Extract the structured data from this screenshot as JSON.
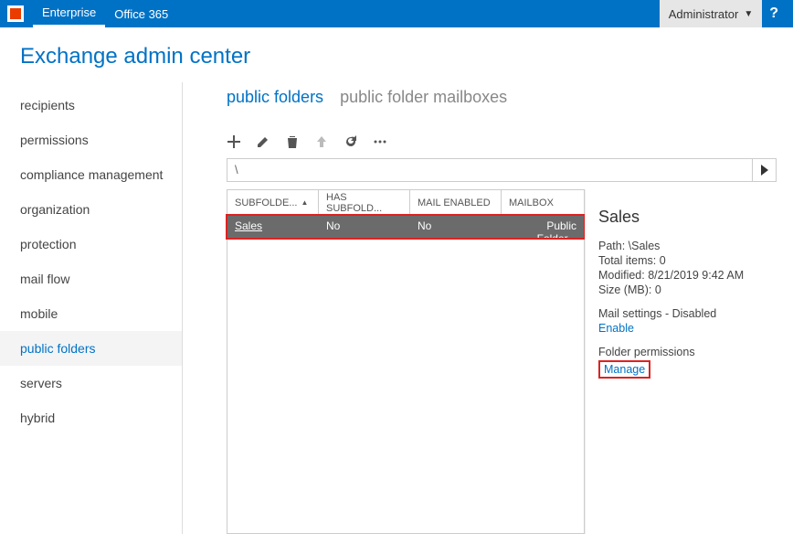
{
  "topbar": {
    "tabs": [
      "Enterprise",
      "Office 365"
    ],
    "active_tab": 0,
    "user": "Administrator",
    "help": "?"
  },
  "page_title": "Exchange admin center",
  "sidebar": {
    "items": [
      "recipients",
      "permissions",
      "compliance management",
      "organization",
      "protection",
      "mail flow",
      "mobile",
      "public folders",
      "servers",
      "hybrid"
    ],
    "active_index": 7
  },
  "content_tabs": {
    "items": [
      "public folders",
      "public folder mailboxes"
    ],
    "active_index": 0
  },
  "toolbar_icons": [
    "add",
    "edit",
    "delete",
    "up",
    "refresh",
    "more"
  ],
  "path": "\\",
  "grid": {
    "columns": [
      "SUBFOLDE...",
      "HAS SUBFOLD...",
      "MAIL ENABLED",
      "MAILBOX"
    ],
    "sort_col": 0,
    "sort_dir": "asc",
    "rows": [
      {
        "subfolder": "Sales",
        "has_sub": "No",
        "mail_enabled": "No",
        "mailbox": "Public Folder..."
      }
    ]
  },
  "details": {
    "title": "Sales",
    "path_label": "Path:",
    "path_value": "\\Sales",
    "total_label": "Total items:",
    "total_value": "0",
    "modified_label": "Modified:",
    "modified_value": "8/21/2019 9:42 AM",
    "size_label": "Size (MB):",
    "size_value": "0",
    "mail_settings": "Mail settings - Disabled",
    "enable_link": "Enable",
    "perms_label": "Folder permissions",
    "manage_link": "Manage"
  }
}
